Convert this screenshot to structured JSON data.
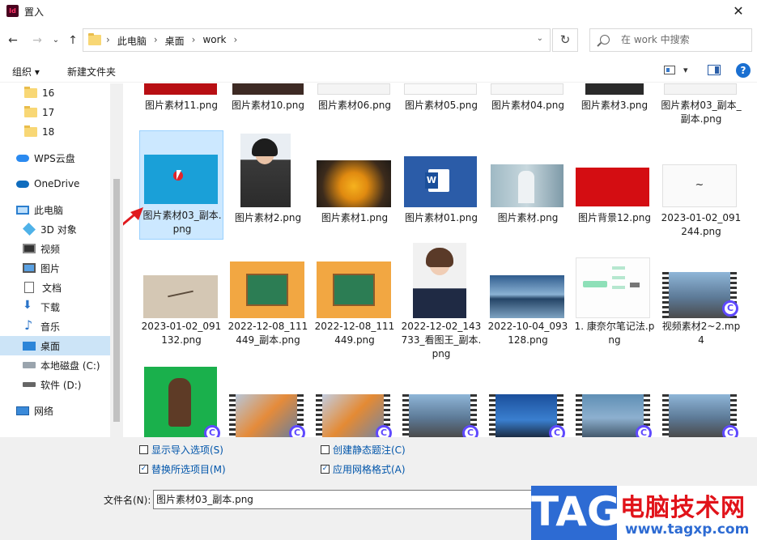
{
  "window": {
    "title": "置入",
    "app_icon": "Id",
    "close_glyph": "✕"
  },
  "nav": {
    "back_glyph": "←",
    "forward_glyph": "→",
    "recent_glyph": "⌄",
    "up_glyph": "↑"
  },
  "address": {
    "crumbs": [
      "此电脑",
      "桌面",
      "work"
    ],
    "separator": "›",
    "dropdown_glyph": "⌄",
    "refresh_glyph": "↻"
  },
  "search": {
    "placeholder": "在 work 中搜索"
  },
  "toolbar": {
    "organize_label": "组织",
    "organize_caret": "▾",
    "new_folder_label": "新建文件夹",
    "view_caret": "▾",
    "help_label": "?"
  },
  "sidebar": {
    "items": [
      {
        "label": "16",
        "icon": "folder-icon"
      },
      {
        "label": "17",
        "icon": "folder-icon"
      },
      {
        "label": "18",
        "icon": "folder-icon"
      },
      {
        "label": "WPS云盘",
        "icon": "cloud-icon"
      },
      {
        "label": "OneDrive",
        "icon": "onedrive-icon"
      },
      {
        "label": "此电脑",
        "icon": "computer-icon"
      },
      {
        "label": "3D 对象",
        "icon": "3d-objects-icon"
      },
      {
        "label": "视频",
        "icon": "videos-icon"
      },
      {
        "label": "图片",
        "icon": "pictures-icon"
      },
      {
        "label": "文档",
        "icon": "documents-icon"
      },
      {
        "label": "下载",
        "icon": "downloads-icon"
      },
      {
        "label": "音乐",
        "icon": "music-icon"
      },
      {
        "label": "桌面",
        "icon": "desktop-icon",
        "selected": true
      },
      {
        "label": "本地磁盘 (C:)",
        "icon": "drive-c-icon"
      },
      {
        "label": "软件 (D:)",
        "icon": "drive-d-icon"
      },
      {
        "label": "网络",
        "icon": "network-icon"
      }
    ]
  },
  "files": {
    "row1": [
      "图片素材11.png",
      "图片素材10.png",
      "图片素材06.png",
      "图片素材05.png",
      "图片素材04.png",
      "图片素材3.png",
      "图片素材03_副本_副本.png"
    ],
    "row2": [
      "图片素材03_副本.png",
      "图片素材2.png",
      "图片素材1.png",
      "图片素材01.png",
      "图片素材.png",
      "图片背景12.png",
      "2023-01-02_091244.png"
    ],
    "row3": [
      "2023-01-02_091132.png",
      "2022-12-08_111449_副本.png",
      "2022-12-08_111449.png",
      "2022-12-02_143733_看图王_副本.png",
      "2022-10-04_093128.png",
      "1. 康奈尔笔记法.png",
      "视频素材2~2.mp4"
    ],
    "selected": "图片素材03_副本.png",
    "badge_letter": "C"
  },
  "options": {
    "show_import_options": {
      "label": "显示导入选项(S)",
      "checked": false
    },
    "replace_selected": {
      "label": "替换所选项目(M)",
      "checked": true
    },
    "create_static_caption": {
      "label": "创建静态题注(C)",
      "checked": false
    },
    "apply_grid_format": {
      "label": "应用网格格式(A)",
      "checked": true
    },
    "check_glyph": "✓"
  },
  "filename": {
    "label": "文件名(N):",
    "value": "图片素材03_副本.png"
  },
  "watermark": {
    "tag": "TAG",
    "cn": "电脑技术网",
    "url": "www.tagxp.com"
  },
  "colors": {
    "selection": "#cce8ff",
    "accent": "#1a6fd1",
    "link_text": "#0055aa",
    "arrow": "#e0191e"
  }
}
